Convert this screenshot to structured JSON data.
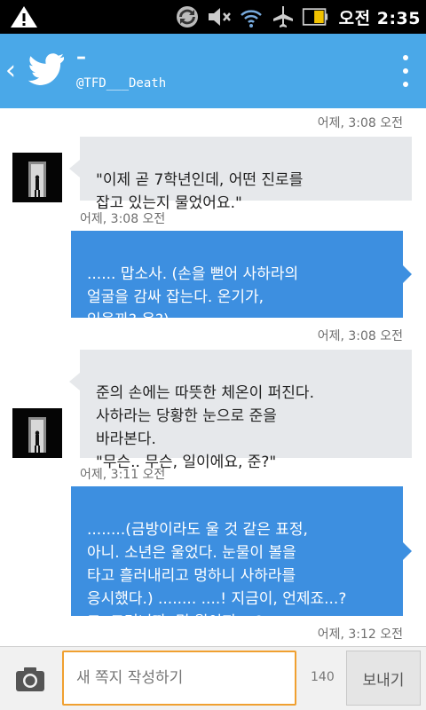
{
  "status_bar": {
    "time": "오전 2:35",
    "icons": [
      "warning-icon",
      "sync-icon",
      "mute-icon",
      "wifi-icon",
      "airplane-icon",
      "battery-icon"
    ]
  },
  "header": {
    "title": "–",
    "handle": "@TFD___Death",
    "accent_color": "#4aa8e8"
  },
  "messages": [
    {
      "direction": "timestamp",
      "text": "어제, 3:08 오전"
    },
    {
      "direction": "in",
      "text": "\"이제 곧 7학년인데, 어떤 진로를\n잡고 있는지 물었어요.\""
    },
    {
      "direction": "timestamp",
      "text": "어제, 3:08 오전"
    },
    {
      "direction": "out",
      "text": "...... 맙소사. (손을 뻗어 사하라의\n얼굴을 감싸 잡는다. 온기가,\n있을까? 응?)"
    },
    {
      "direction": "timestamp",
      "text": "어제, 3:08 오전"
    },
    {
      "direction": "in",
      "text": "준의 손에는 따뜻한 체온이 퍼진다.\n사하라는 당황한 눈으로 준을\n바라본다.\n\"무슨.. 무슨, 일이에요, 준?\""
    },
    {
      "direction": "timestamp",
      "text": "어제, 3:11 오전"
    },
    {
      "direction": "out",
      "text": "........(금방이라도 울 것 같은 표정,\n아니. 소년은 울었다. 눈물이 볼을\n타고 흘러내리고 멍하니 사하라를\n응시했다.) ........ ....!  지금이, 언제죠...?\n그, 그러니까. 몇 월이지....?"
    },
    {
      "direction": "timestamp",
      "text": "어제, 3:12 오전"
    }
  ],
  "compose": {
    "placeholder": "새 쪽지 작성하기",
    "char_count": "140",
    "send_label": "보내기"
  }
}
